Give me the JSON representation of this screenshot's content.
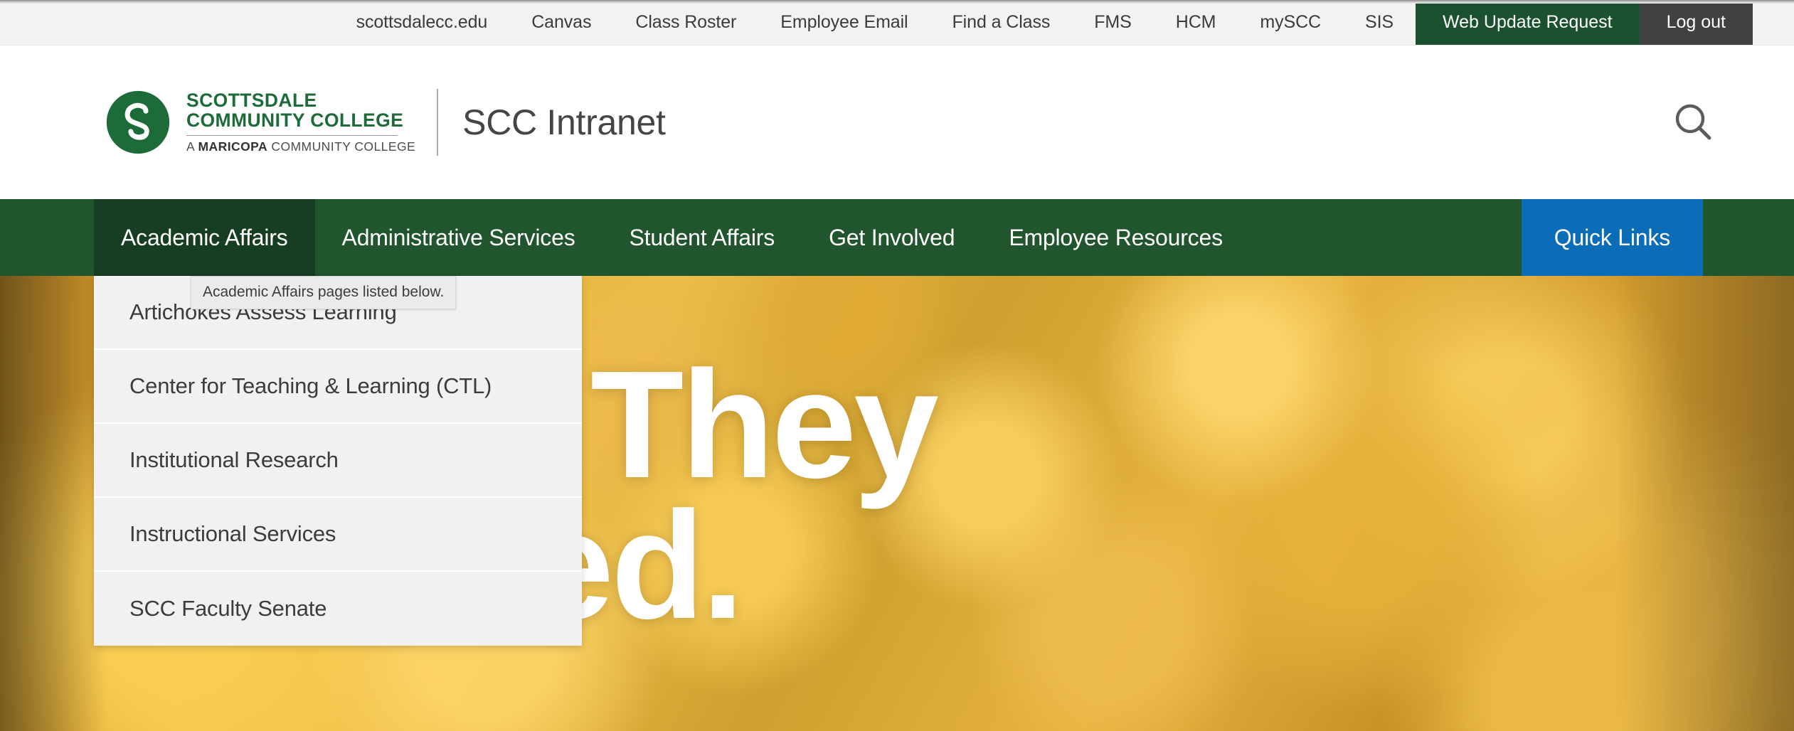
{
  "utility_bar": {
    "links": [
      {
        "label": "scottsdalecc.edu"
      },
      {
        "label": "Canvas"
      },
      {
        "label": "Class Roster"
      },
      {
        "label": "Employee Email"
      },
      {
        "label": "Find a Class"
      },
      {
        "label": "FMS"
      },
      {
        "label": "HCM"
      },
      {
        "label": "mySCC"
      },
      {
        "label": "SIS"
      }
    ],
    "web_update_label": "Web Update Request",
    "logout_label": "Log out",
    "web_update_color": "#1c5130",
    "logout_color": "#414141",
    "background_color": "#f2f2f2"
  },
  "masthead": {
    "logo": {
      "seal_letter": "S",
      "line1": "SCOTTSDALE",
      "line2": "COMMUNITY COLLEGE",
      "line3_prefix": "A ",
      "line3_bold": "MARICOPA",
      "line3_suffix": " COMMUNITY COLLEGE",
      "green": "#1c6b38"
    },
    "site_title": "SCC Intranet",
    "search_icon": "search-icon"
  },
  "main_nav": {
    "background_color": "#21552e",
    "active_color": "#173d22",
    "quick_links_color": "#0b6cb7",
    "items": [
      {
        "label": "Academic Affairs",
        "active": true
      },
      {
        "label": "Administrative Services",
        "active": false
      },
      {
        "label": "Student Affairs",
        "active": false
      },
      {
        "label": "Get Involved",
        "active": false
      },
      {
        "label": "Employee Resources",
        "active": false
      }
    ],
    "quick_links_label": "Quick Links"
  },
  "tooltip": {
    "text": "Academic Affairs pages listed below."
  },
  "dropdown": {
    "parent": "Academic Affairs",
    "items": [
      {
        "label": "Artichokes Assess Learning"
      },
      {
        "label": "Center for Teaching & Learning (CTL)"
      },
      {
        "label": "Institutional Research"
      },
      {
        "label": "Instructional Services"
      },
      {
        "label": "SCC Faculty Senate"
      }
    ]
  },
  "hero": {
    "line1": "They",
    "line2": "Succeed.",
    "text_color": "#ffffff"
  }
}
